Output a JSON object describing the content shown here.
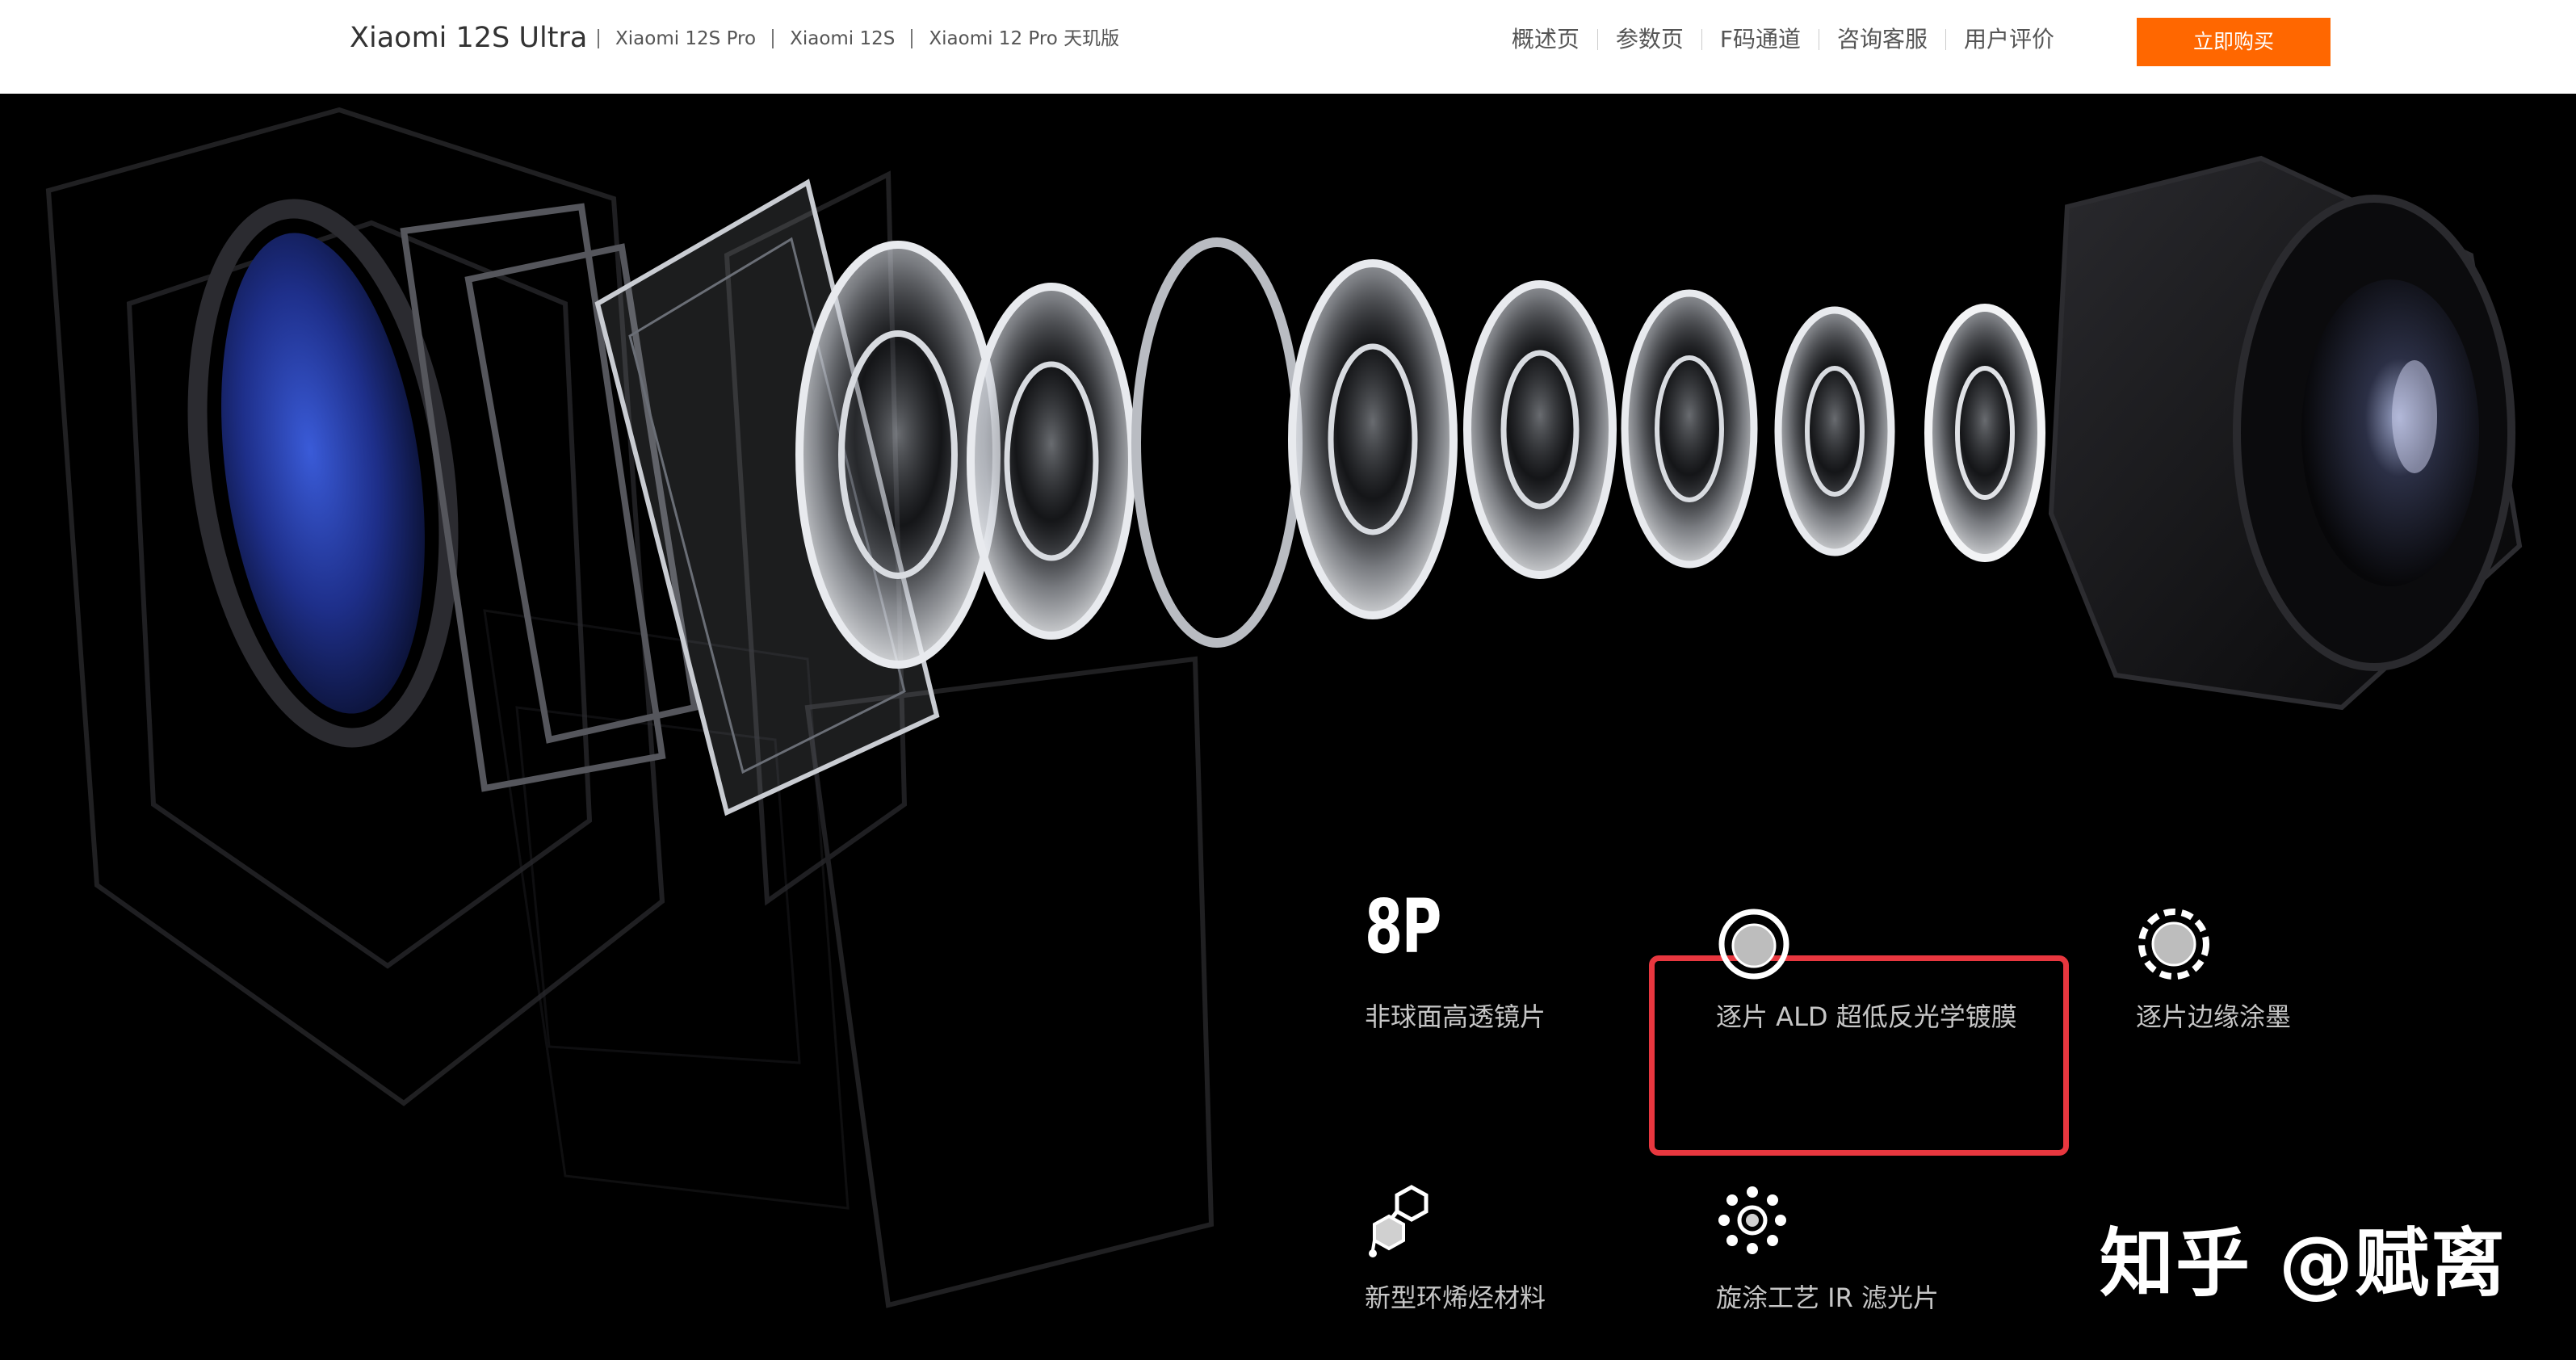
{
  "header": {
    "brand": "Xiaomi 12S Ultra",
    "models": [
      "Xiaomi 12S Pro",
      "Xiaomi 12S",
      "Xiaomi 12 Pro 天玑版"
    ],
    "nav": [
      "概述页",
      "参数页",
      "F码通道",
      "咨询客服",
      "用户评价"
    ],
    "buy_label": "立即购买",
    "accent_color": "#ff6700"
  },
  "features": [
    {
      "icon": "8P",
      "label": "非球面高透镜片"
    },
    {
      "icon": "lens-ring-icon",
      "label": "逐片 ALD 超低反光学镀膜",
      "highlighted": true
    },
    {
      "icon": "dashed-ring-icon",
      "label": "逐片边缘涂墨"
    },
    {
      "icon": "hexagon-molecule-icon",
      "label": "新型环烯烃材料"
    },
    {
      "icon": "dot-cluster-icon",
      "label": "旋涂工艺 IR 滤光片"
    }
  ],
  "watermark": "知乎 @赋离",
  "highlight_color": "#e8373f"
}
